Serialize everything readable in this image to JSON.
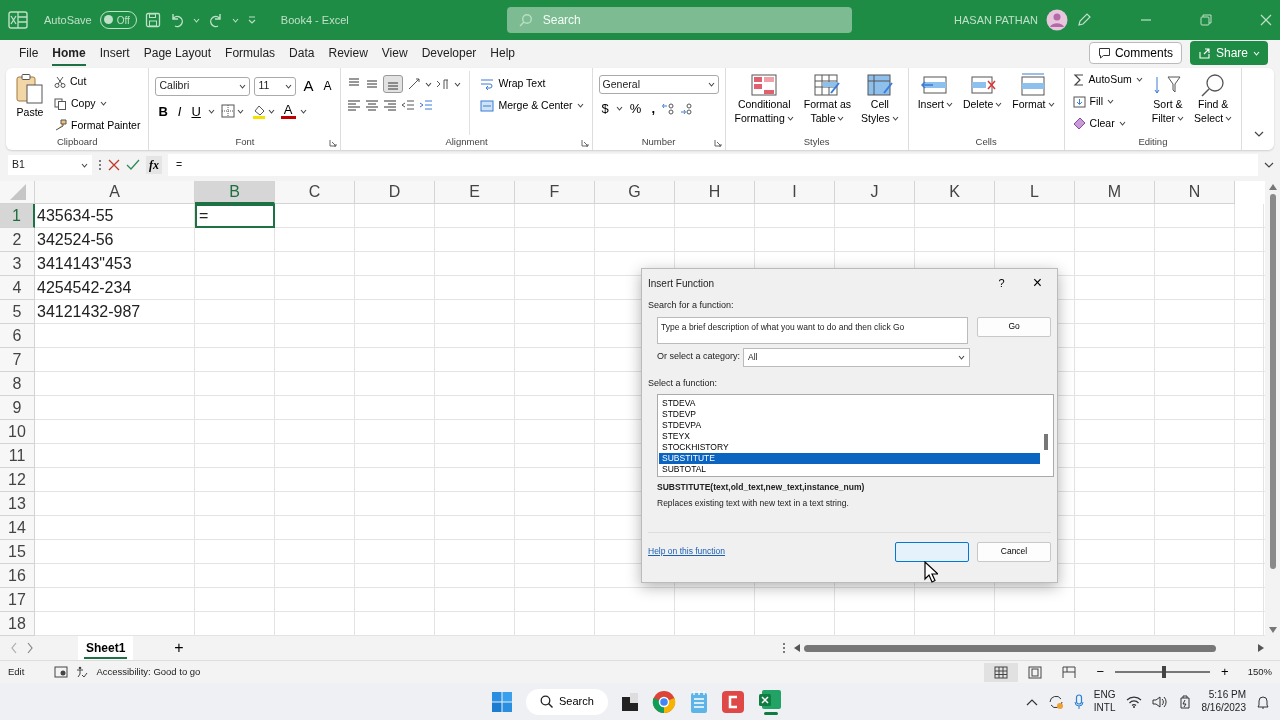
{
  "title_bar": {
    "autosave_label": "AutoSave",
    "autosave_state": "Off",
    "autosave_on": false,
    "document_title": "Book4  -  Excel",
    "search_placeholder": "Search",
    "user_name": "HASAN PATHAN"
  },
  "menu_tabs": [
    {
      "label": "File",
      "selected": false
    },
    {
      "label": "Home",
      "selected": true
    },
    {
      "label": "Insert",
      "selected": false
    },
    {
      "label": "Page Layout",
      "selected": false
    },
    {
      "label": "Formulas",
      "selected": false
    },
    {
      "label": "Data",
      "selected": false
    },
    {
      "label": "Review",
      "selected": false
    },
    {
      "label": "View",
      "selected": false
    },
    {
      "label": "Developer",
      "selected": false
    },
    {
      "label": "Help",
      "selected": false
    }
  ],
  "comments_button": "Comments",
  "share_button": "Share",
  "ribbon_groups": [
    {
      "kind": "clipboard",
      "label": "Clipboard",
      "paste": "Paste",
      "cut": "Cut",
      "copy": "Copy",
      "format_painter": "Format Painter"
    },
    {
      "kind": "font",
      "label": "Font",
      "font_name": "Calibri",
      "font_size": "11",
      "grow": "A",
      "shrink": "A",
      "bold": "B",
      "italic": "I",
      "underline": "U",
      "font_color": "A"
    },
    {
      "kind": "alignment",
      "label": "Alignment",
      "bottom_align_selected": true,
      "wrap_text": "Wrap Text",
      "merge_center": "Merge & Center"
    },
    {
      "kind": "number",
      "label": "Number",
      "format": "General",
      "currency": "$",
      "percent": "%",
      "comma": ","
    },
    {
      "kind": "styles",
      "label": "Styles",
      "buttons": [
        [
          "Conditional",
          "Formatting"
        ],
        [
          "Format as",
          "Table"
        ],
        [
          "Cell",
          "Styles"
        ]
      ]
    },
    {
      "kind": "cells",
      "label": "Cells",
      "buttons": [
        "Insert",
        "Delete",
        "Format"
      ]
    },
    {
      "kind": "editing",
      "label": "Editing",
      "autosum": "AutoSum",
      "fill": "Fill",
      "clear": "Clear",
      "sort_filter": [
        "Sort &",
        "Filter"
      ],
      "find_select": [
        "Find &",
        "Select"
      ]
    }
  ],
  "formula_bar": {
    "name_box": "B1",
    "fx": "fx",
    "formula": "="
  },
  "sheet": {
    "columns": [
      {
        "label": "A",
        "selected": false
      },
      {
        "label": "B",
        "selected": true
      },
      {
        "label": "C",
        "selected": false
      },
      {
        "label": "D",
        "selected": false
      },
      {
        "label": "E",
        "selected": false
      },
      {
        "label": "F",
        "selected": false
      },
      {
        "label": "G",
        "selected": false
      },
      {
        "label": "H",
        "selected": false
      },
      {
        "label": "I",
        "selected": false
      },
      {
        "label": "J",
        "selected": false
      },
      {
        "label": "K",
        "selected": false
      },
      {
        "label": "L",
        "selected": false
      },
      {
        "label": "M",
        "selected": false
      },
      {
        "label": "N",
        "selected": false
      }
    ],
    "rows": [
      {
        "header": "1",
        "selected": true,
        "cells": [
          {
            "text": "435634-55",
            "active": false
          },
          {
            "text": "=",
            "active": true
          }
        ]
      },
      {
        "header": "2",
        "selected": false,
        "cells": [
          {
            "text": "342524-56",
            "active": false
          }
        ]
      },
      {
        "header": "3",
        "selected": false,
        "cells": [
          {
            "text": "3414143\"453",
            "active": false
          }
        ]
      },
      {
        "header": "4",
        "selected": false,
        "cells": [
          {
            "text": "4254542-234",
            "active": false
          }
        ]
      },
      {
        "header": "5",
        "selected": false,
        "cells": [
          {
            "text": "34121432-987",
            "active": false
          }
        ]
      },
      {
        "header": "6",
        "selected": false
      },
      {
        "header": "7",
        "selected": false
      },
      {
        "header": "8",
        "selected": false
      },
      {
        "header": "9",
        "selected": false
      },
      {
        "header": "10",
        "selected": false
      },
      {
        "header": "11",
        "selected": false
      },
      {
        "header": "12",
        "selected": false
      },
      {
        "header": "13",
        "selected": false
      },
      {
        "header": "14",
        "selected": false
      },
      {
        "header": "15",
        "selected": false
      },
      {
        "header": "16",
        "selected": false
      },
      {
        "header": "17",
        "selected": false
      },
      {
        "header": "18",
        "selected": false
      }
    ]
  },
  "sheet_tabs": [
    {
      "label": "Sheet1",
      "selected": true
    }
  ],
  "add_sheet": "+",
  "status_bar": {
    "mode": "Edit",
    "accessibility": "Accessibility: Good to go",
    "view_buttons": [
      {
        "selected": true
      },
      {
        "selected": false
      },
      {
        "selected": false
      }
    ],
    "zoom_minus": "−",
    "zoom_plus": "+",
    "zoom_slider": {
      "level": 0.52
    },
    "zoom": "150%"
  },
  "dialog": {
    "title": "Insert Function",
    "help": "?",
    "close": "×",
    "search_label": "Search for a function:",
    "search_value": "Type a brief description of what you want to do and then click Go",
    "go_button": "Go",
    "category_label": "Or select a category:",
    "category_value": "All",
    "function_label": "Select a function:",
    "functions": [
      {
        "label": "STDEVA",
        "selected": false
      },
      {
        "label": "STDEVP",
        "selected": false
      },
      {
        "label": "STDEVPA",
        "selected": false
      },
      {
        "label": "STEYX",
        "selected": false
      },
      {
        "label": "STOCKHISTORY",
        "selected": false
      },
      {
        "label": "SUBSTITUTE",
        "selected": true
      },
      {
        "label": "SUBTOTAL",
        "selected": false
      }
    ],
    "signature": "SUBSTITUTE(text,old_text,new_text,instance_num)",
    "description": "Replaces existing text with new text in a text string.",
    "help_link": "Help on this function",
    "cancel_button": "Cancel"
  },
  "taskbar": {
    "search": "Search",
    "language": [
      "ENG",
      "INTL"
    ],
    "time": "5:16 PM",
    "date": "8/16/2023"
  }
}
